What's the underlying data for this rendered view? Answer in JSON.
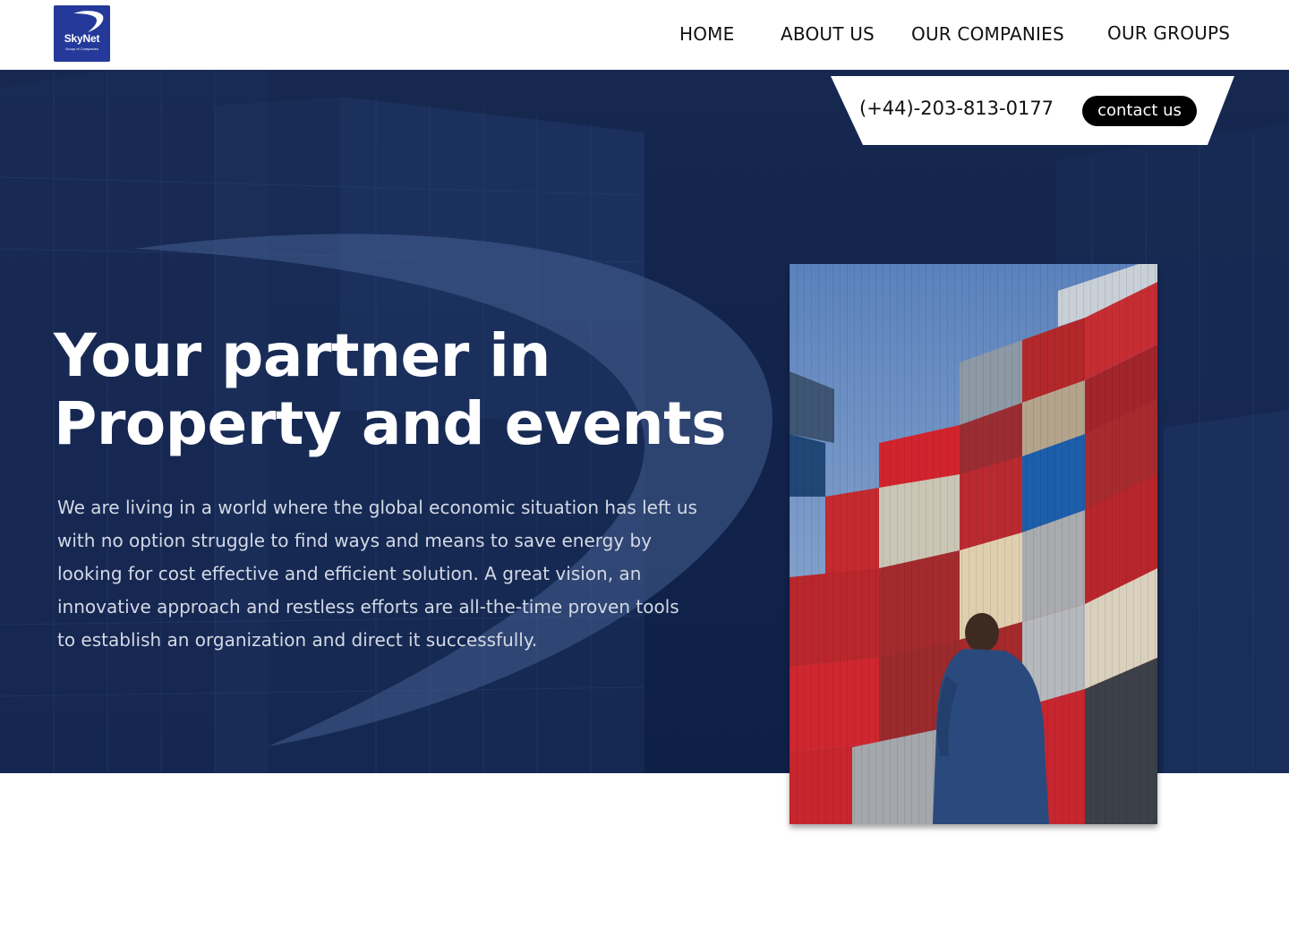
{
  "brand": {
    "name": "SkyNet",
    "tagline": "Group of Companies",
    "color": "#24399a"
  },
  "nav": {
    "items": [
      {
        "label": "HOME"
      },
      {
        "label": "ABOUT US"
      },
      {
        "label": "OUR COMPANIES"
      },
      {
        "label": "OUR GROUPS"
      }
    ]
  },
  "contact": {
    "phone": "(+44)-203-813-0177",
    "button_label": "contact us"
  },
  "hero": {
    "title_line1": "Your partner in",
    "title_line2": "Property and events",
    "description": "We are living in a world where the global economic situation has left us with no option struggle to find ways and means to save energy by looking for cost effective and efficient solution. A great vision, an innovative approach and restless efforts are all-the-time proven tools to establish an organization and direct it successfully.",
    "background_color": "#12244c",
    "image_subject": "person looking up at stacked shipping containers"
  },
  "colors": {
    "header_bg": "#ffffff",
    "hero_text": "#ffffff",
    "button_bg": "#000000",
    "button_text": "#ffffff"
  }
}
